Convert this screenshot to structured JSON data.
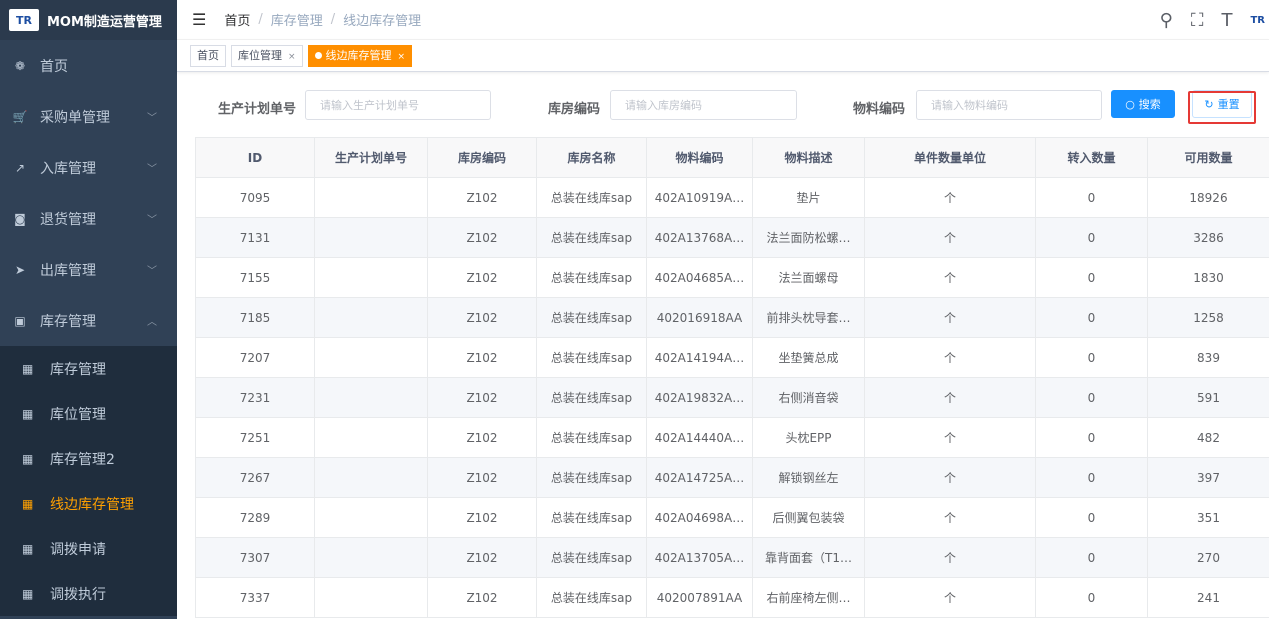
{
  "app": {
    "title": "MOM制造运营管理",
    "logo_text": "TR"
  },
  "sidebar": {
    "items": [
      {
        "label": "首页",
        "icon": "dashboard-icon",
        "glyph": "❁"
      },
      {
        "label": "采购单管理",
        "icon": "cart-icon",
        "glyph": "🛒",
        "arrow": "﹀"
      },
      {
        "label": "入库管理",
        "icon": "export-icon",
        "glyph": "↗",
        "arrow": "﹀"
      },
      {
        "label": "退货管理",
        "icon": "return-icon",
        "glyph": "◙",
        "arrow": "﹀"
      },
      {
        "label": "出库管理",
        "icon": "send-icon",
        "glyph": "➤",
        "arrow": "﹀"
      },
      {
        "label": "库存管理",
        "icon": "monitor-icon",
        "glyph": "▣",
        "arrow": "︿"
      }
    ],
    "submenu": [
      {
        "label": "库存管理",
        "active": false
      },
      {
        "label": "库位管理",
        "active": false
      },
      {
        "label": "库存管理2",
        "active": false
      },
      {
        "label": "线边库存管理",
        "active": true
      },
      {
        "label": "调拨申请",
        "active": false
      },
      {
        "label": "调拨执行",
        "active": false
      }
    ]
  },
  "navbar": {
    "breadcrumb": [
      "首页",
      "库存管理",
      "线边库存管理"
    ],
    "logo_text": "TR"
  },
  "tags": [
    {
      "label": "首页",
      "closable": false,
      "active": false
    },
    {
      "label": "库位管理",
      "closable": true,
      "active": false
    },
    {
      "label": "线边库存管理",
      "closable": true,
      "active": true
    }
  ],
  "search": {
    "plan_label": "生产计划单号",
    "plan_placeholder": "请输入生产计划单号",
    "warehouse_label": "库房编码",
    "warehouse_placeholder": "请输入库房编码",
    "material_label": "物料编码",
    "material_placeholder": "请输入物料编码",
    "search_button": "搜索",
    "reset_button": "重置"
  },
  "table": {
    "columns": [
      "ID",
      "生产计划单号",
      "库房编码",
      "库房名称",
      "物料编码",
      "物料描述",
      "单件数量单位",
      "转入数量",
      "可用数量"
    ],
    "rows": [
      [
        "7095",
        "",
        "Z102",
        "总装在线库sap",
        "402A10919A…",
        "垫片",
        "个",
        "0",
        "18926"
      ],
      [
        "7131",
        "",
        "Z102",
        "总装在线库sap",
        "402A13768A…",
        "法兰面防松螺…",
        "个",
        "0",
        "3286"
      ],
      [
        "7155",
        "",
        "Z102",
        "总装在线库sap",
        "402A04685A…",
        "法兰面螺母",
        "个",
        "0",
        "1830"
      ],
      [
        "7185",
        "",
        "Z102",
        "总装在线库sap",
        "402016918AA",
        "前排头枕导套…",
        "个",
        "0",
        "1258"
      ],
      [
        "7207",
        "",
        "Z102",
        "总装在线库sap",
        "402A14194A…",
        "坐垫簧总成",
        "个",
        "0",
        "839"
      ],
      [
        "7231",
        "",
        "Z102",
        "总装在线库sap",
        "402A19832A…",
        "右侧消音袋",
        "个",
        "0",
        "591"
      ],
      [
        "7251",
        "",
        "Z102",
        "总装在线库sap",
        "402A14440A…",
        "头枕EPP",
        "个",
        "0",
        "482"
      ],
      [
        "7267",
        "",
        "Z102",
        "总装在线库sap",
        "402A14725A…",
        "解锁钢丝左",
        "个",
        "0",
        "397"
      ],
      [
        "7289",
        "",
        "Z102",
        "总装在线库sap",
        "402A04698A…",
        "后侧翼包装袋",
        "个",
        "0",
        "351"
      ],
      [
        "7307",
        "",
        "Z102",
        "总装在线库sap",
        "402A13705A…",
        "靠背面套（T1…",
        "个",
        "0",
        "270"
      ],
      [
        "7337",
        "",
        "Z102",
        "总装在线库sap",
        "402007891AA",
        "右前座椅左侧…",
        "个",
        "0",
        "241"
      ]
    ]
  }
}
